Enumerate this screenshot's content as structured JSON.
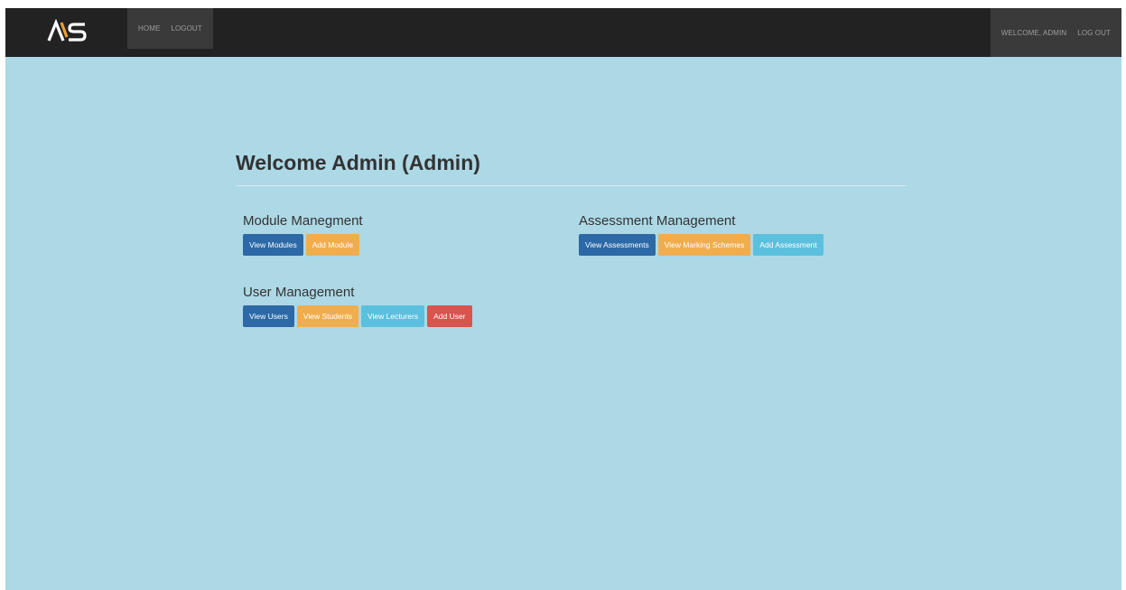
{
  "navbar": {
    "left_links": [
      "HOME",
      "LOGOUT"
    ],
    "right_links": [
      "WELCOME, ADMIN",
      "LOG OUT"
    ]
  },
  "main": {
    "title": "Welcome Admin (Admin)"
  },
  "sections": {
    "module": {
      "heading": "Module Manegment",
      "buttons": [
        "View Modules",
        "Add Module"
      ]
    },
    "assessment": {
      "heading": "Assessment Management",
      "buttons": [
        "View Assessments",
        "View Marking Schemes",
        "Add Assessment"
      ]
    },
    "user": {
      "heading": "User Management",
      "buttons": [
        "View Users",
        "View Students",
        "View Lecturers",
        "Add User"
      ]
    }
  },
  "colors": {
    "navbar_bg": "#222222",
    "page_bg": "#add8e6",
    "primary": "#2c69a6",
    "warning": "#f0ad4e",
    "info": "#5bc0de",
    "danger": "#d9534f",
    "logo_accent": "#f0a030"
  },
  "icons": {
    "brand": "ams-logo"
  }
}
